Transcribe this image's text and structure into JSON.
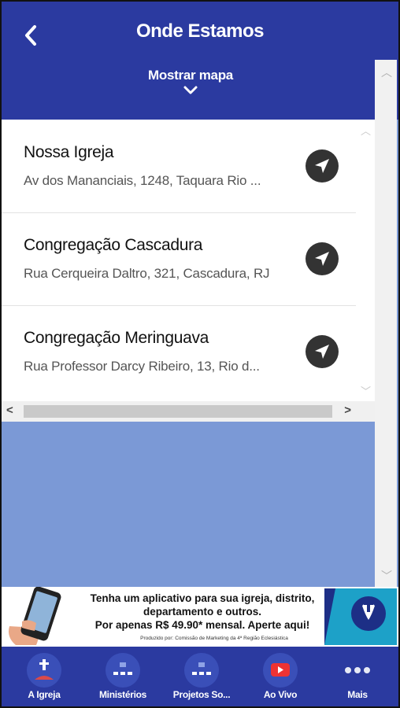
{
  "header": {
    "back_glyph": "<",
    "title": "Onde Estamos",
    "map_toggle_label": "Mostrar mapa"
  },
  "locations": [
    {
      "name": "Nossa Igreja",
      "address": "Av dos Mananciais, 1248, Taquara Rio ..."
    },
    {
      "name": "Congregação Cascadura",
      "address": "Rua Cerqueira Daltro, 321, Cascadura, RJ"
    },
    {
      "name": "Congregação Meringuava",
      "address": "Rua Professor Darcy Ribeiro, 13, Rio d..."
    }
  ],
  "scrollbar": {
    "left_arrow": "<",
    "right_arrow": ">",
    "up_arrow": "^",
    "down_arrow": "v"
  },
  "ad": {
    "line1": "Tenha um aplicativo para sua igreja, distrito,",
    "line2": "departamento e outros.",
    "line3": "Por apenas R$ 49.90* mensal. Aperte aqui!",
    "fine_print": "Produzido por: Comissão de Marketing da 4ª Região Eclesiástica"
  },
  "tabs": [
    {
      "label": "A Igreja",
      "icon": "church-icon"
    },
    {
      "label": "Ministérios",
      "icon": "ministries-icon"
    },
    {
      "label": "Projetos So...",
      "icon": "projects-icon"
    },
    {
      "label": "Ao Vivo",
      "icon": "live-icon"
    },
    {
      "label": "Mais",
      "icon": "more-icon"
    }
  ],
  "colors": {
    "header_bg": "#2b3aa0",
    "background": "#7b99d6",
    "nav_button": "#333333"
  }
}
